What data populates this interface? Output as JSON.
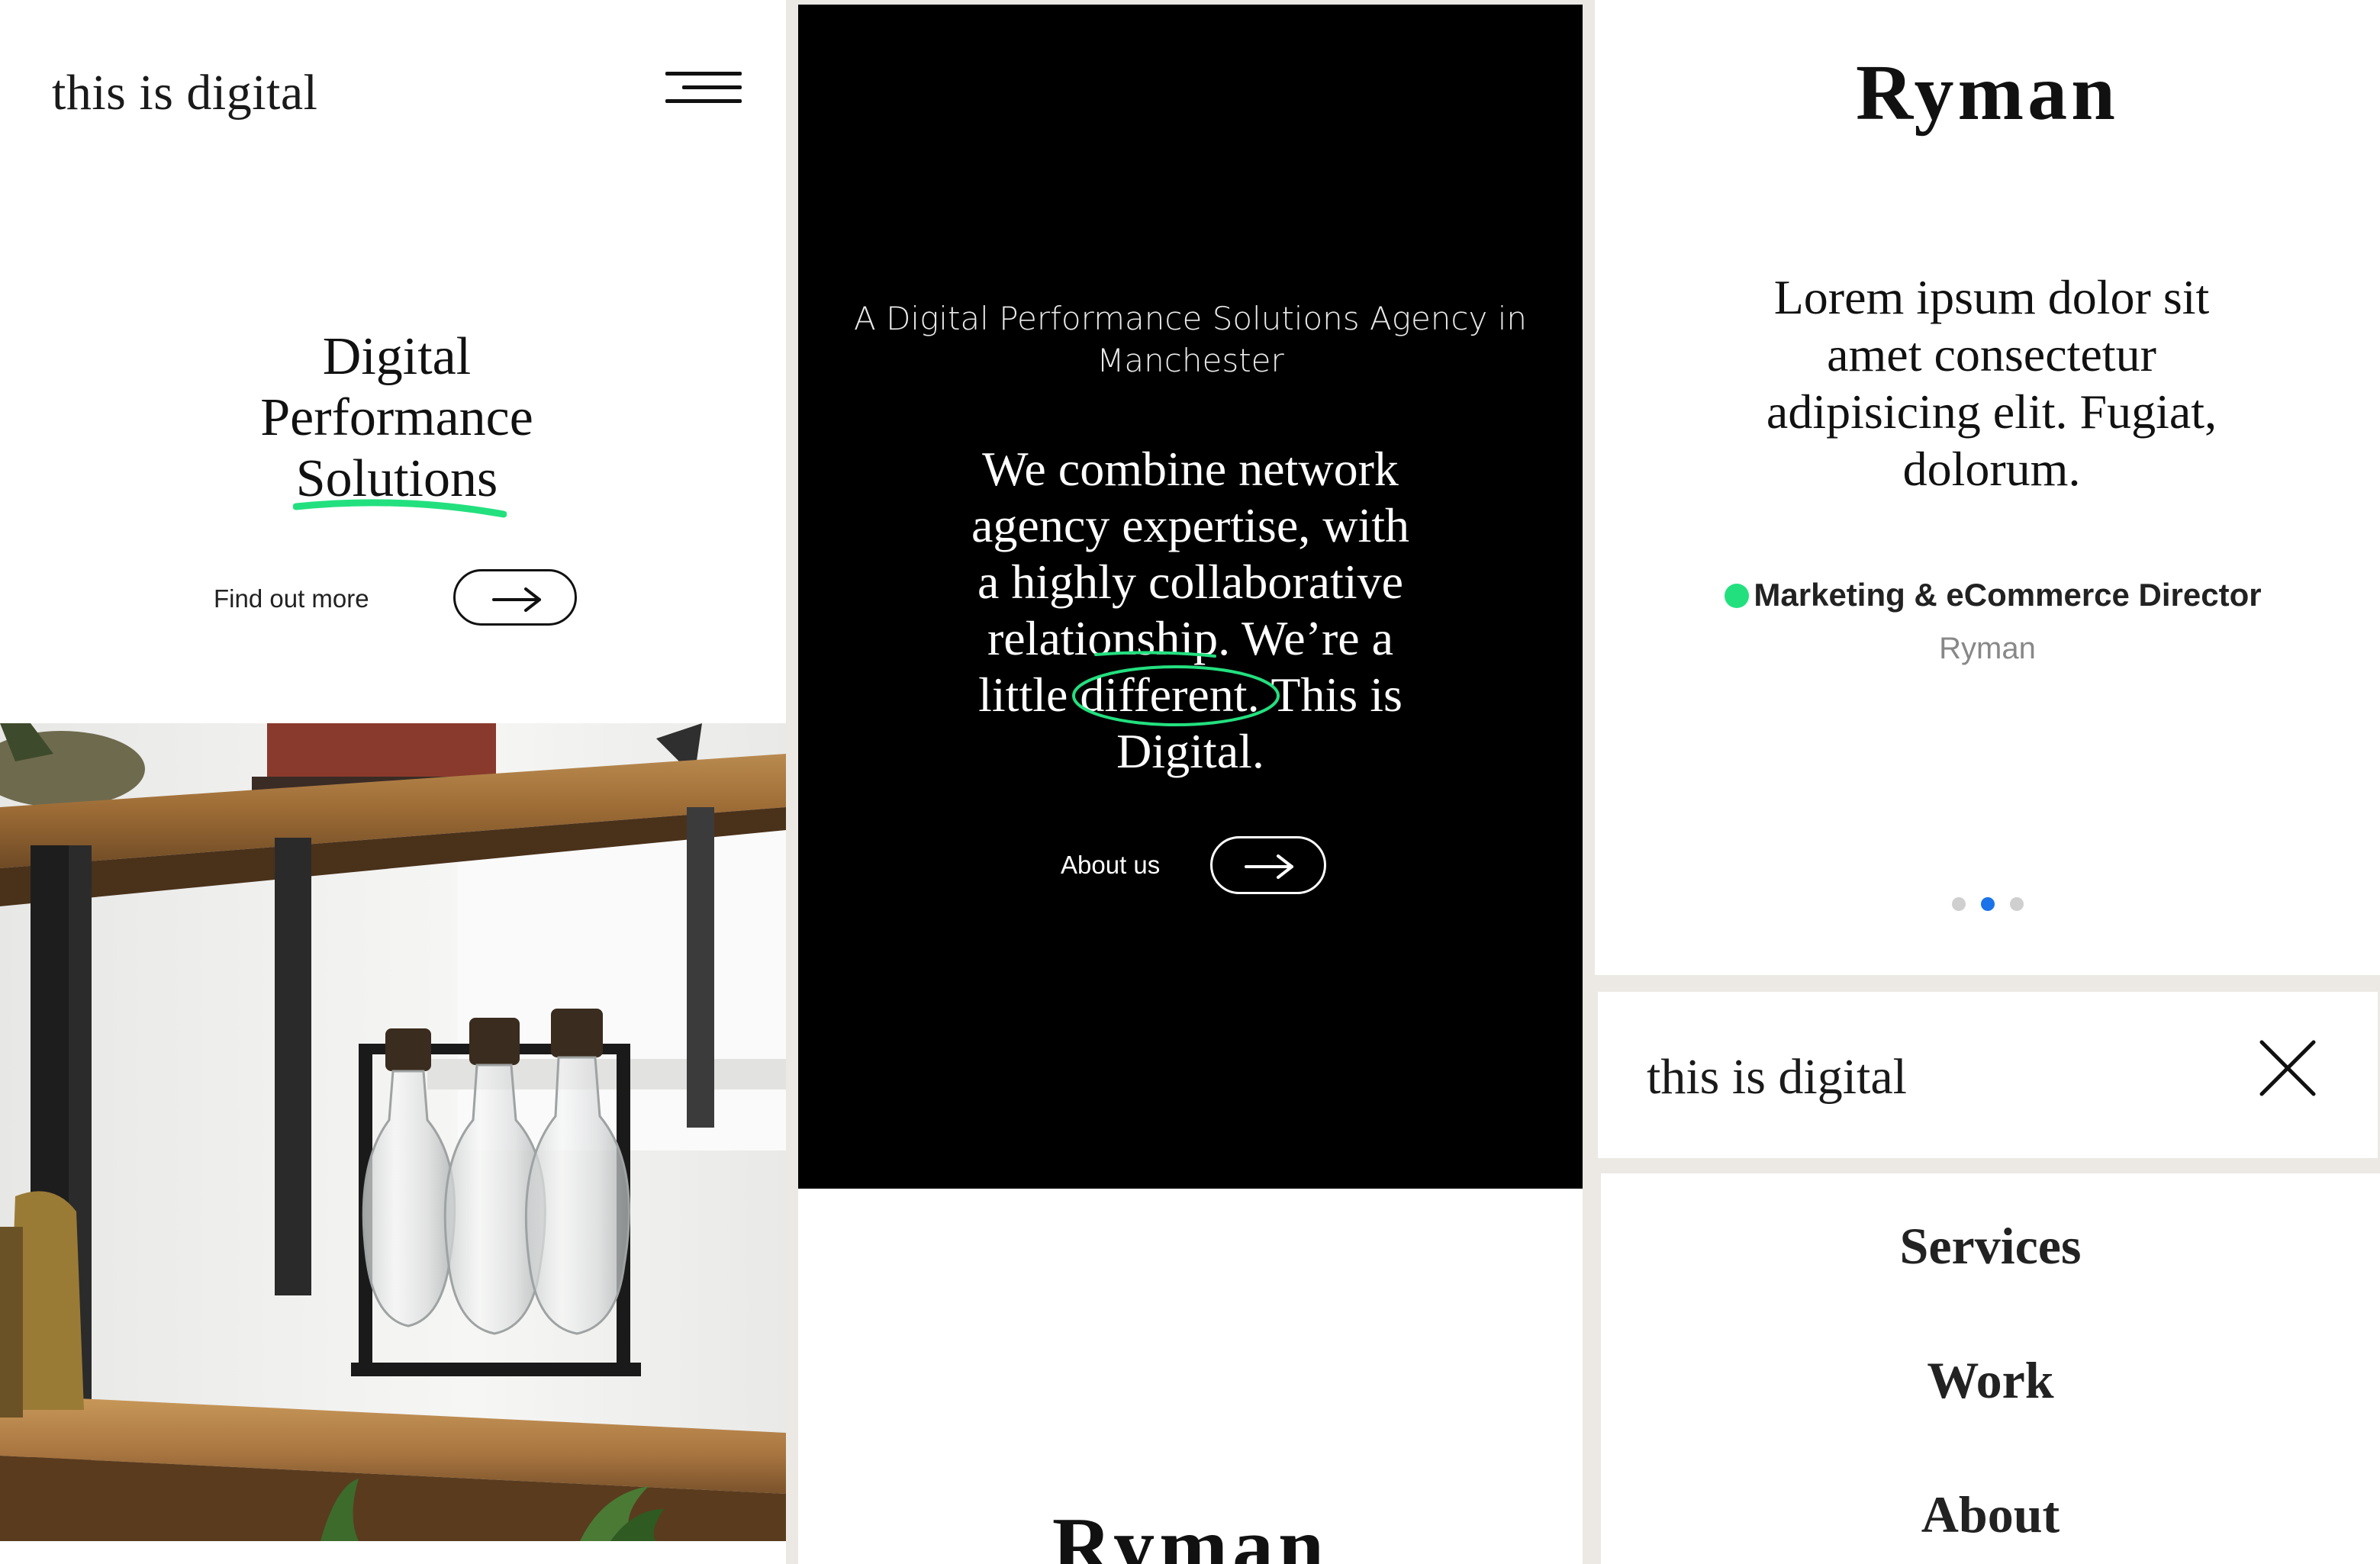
{
  "panel1": {
    "brand": "this is digital",
    "hero_title_line1": "Digital",
    "hero_title_line2": "Performance",
    "hero_title_line3": "Solutions",
    "cta_label": "Find out more"
  },
  "panel2": {
    "kicker_line1": "A Digital Performance Solutions Agency in",
    "kicker_line2": "Manchester",
    "statement": {
      "line1": "We combine network",
      "line2": "agency expertise, with",
      "line3": "a highly collaborative",
      "line4": "relationship. We’re a",
      "line5_before": "little ",
      "line5_circled": "different.",
      "line5_after": " This is",
      "line6": "Digital."
    },
    "cta_label": "About us",
    "client_logo": "Ryman"
  },
  "panel3": {
    "client_logo": "Ryman",
    "quote_line1": "Lorem ipsum dolor sit",
    "quote_line2": "amet consectetur",
    "quote_line3": "adipisicing elit. Fugiat,",
    "quote_line4": "dolorum.",
    "author_role": "Marketing & eCommerce Director",
    "author_company": "Ryman",
    "carousel": {
      "count": 3,
      "active_index": 1
    }
  },
  "menu": {
    "brand": "this is digital",
    "items": [
      {
        "label": "Services"
      },
      {
        "label": "Work"
      },
      {
        "label": "About"
      }
    ]
  },
  "colors": {
    "accent_green": "#23e07f",
    "active_dot": "#1a73e8",
    "background": "#ece9e4"
  },
  "icons": [
    "hamburger-menu-icon",
    "arrow-right-icon",
    "close-icon"
  ]
}
